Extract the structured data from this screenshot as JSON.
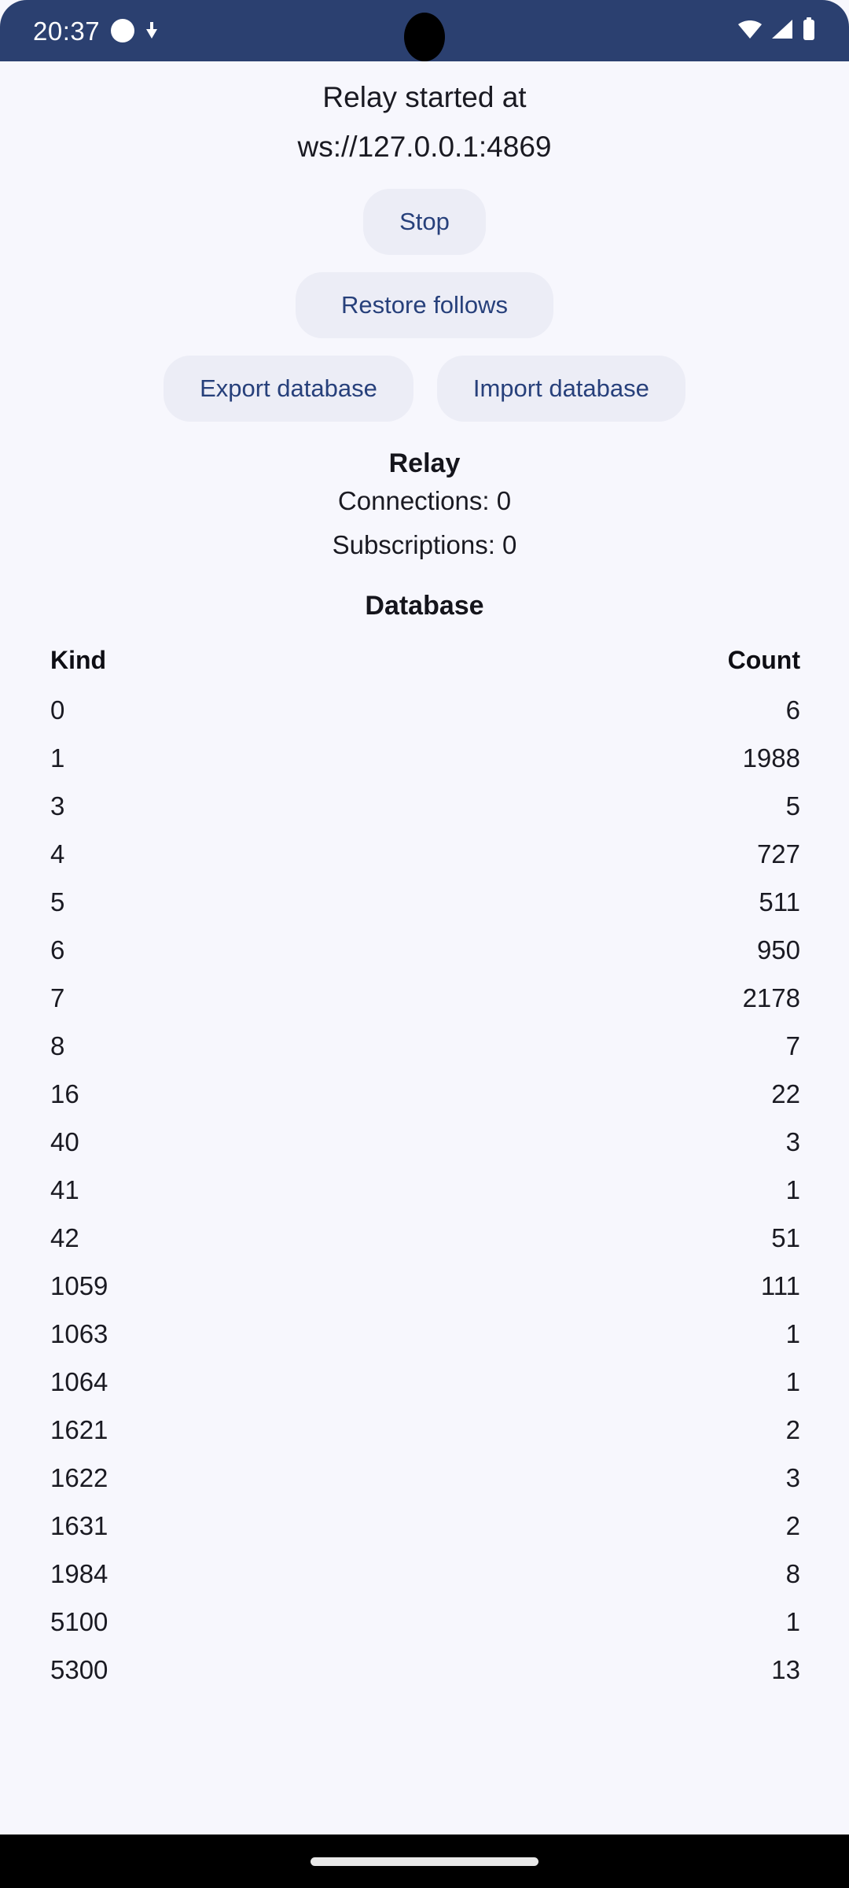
{
  "status_bar": {
    "time": "20:37",
    "left_icons": [
      "circle-indicator-icon",
      "download-icon"
    ],
    "right_icons": [
      "wifi-icon",
      "cellular-signal-icon",
      "battery-icon"
    ],
    "background_color": "#2B4070",
    "foreground_color": "#FFFFFF"
  },
  "header": {
    "line1": "Relay started at",
    "line2": "ws://127.0.0.1:4869"
  },
  "actions": {
    "stop_label": "Stop",
    "restore_follows_label": "Restore follows",
    "export_database_label": "Export database",
    "import_database_label": "Import database",
    "button_background": "#ECEDF6",
    "button_text_color": "#27407B"
  },
  "relay": {
    "title": "Relay",
    "connections": "Connections: 0",
    "subscriptions": "Subscriptions: 0"
  },
  "database": {
    "title": "Database",
    "columns": {
      "kind": "Kind",
      "count": "Count"
    },
    "rows": [
      {
        "kind": "0",
        "count": "6"
      },
      {
        "kind": "1",
        "count": "1988"
      },
      {
        "kind": "3",
        "count": "5"
      },
      {
        "kind": "4",
        "count": "727"
      },
      {
        "kind": "5",
        "count": "511"
      },
      {
        "kind": "6",
        "count": "950"
      },
      {
        "kind": "7",
        "count": "2178"
      },
      {
        "kind": "8",
        "count": "7"
      },
      {
        "kind": "16",
        "count": "22"
      },
      {
        "kind": "40",
        "count": "3"
      },
      {
        "kind": "41",
        "count": "1"
      },
      {
        "kind": "42",
        "count": "51"
      },
      {
        "kind": "1059",
        "count": "111"
      },
      {
        "kind": "1063",
        "count": "1"
      },
      {
        "kind": "1064",
        "count": "1"
      },
      {
        "kind": "1621",
        "count": "2"
      },
      {
        "kind": "1622",
        "count": "3"
      },
      {
        "kind": "1631",
        "count": "2"
      },
      {
        "kind": "1984",
        "count": "8"
      },
      {
        "kind": "5100",
        "count": "1"
      },
      {
        "kind": "5300",
        "count": "13"
      }
    ]
  },
  "nav_bar": {
    "gesture_handle": "home-gesture-pill",
    "background_color": "#000000"
  }
}
